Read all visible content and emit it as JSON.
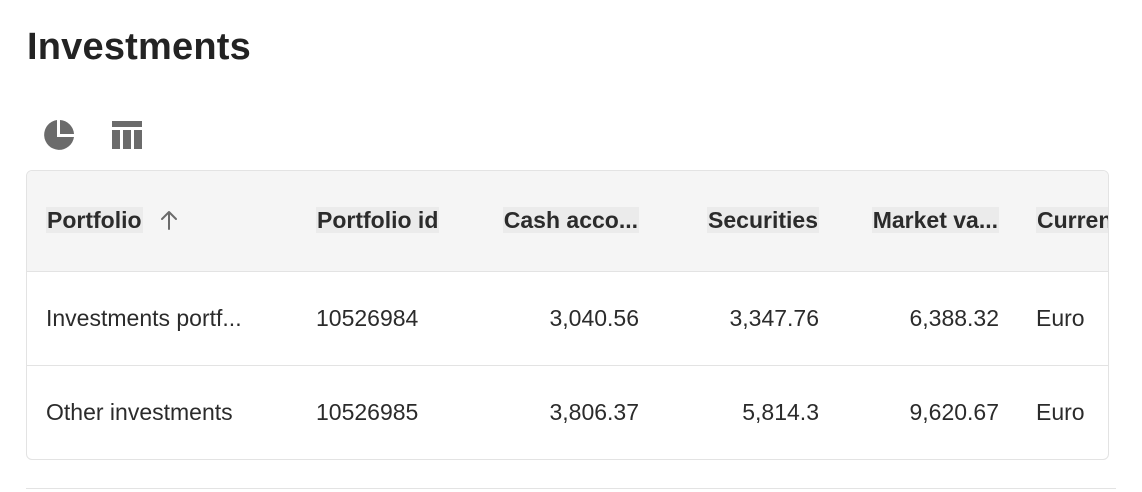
{
  "page": {
    "title": "Investments"
  },
  "view_toggle": {
    "icons": [
      "pie-chart-icon",
      "table-icon"
    ]
  },
  "table": {
    "columns": [
      {
        "key": "portfolio",
        "label": "Portfolio",
        "sorted": "ascending"
      },
      {
        "key": "portfolio_id",
        "label": "Portfolio id"
      },
      {
        "key": "cash_account",
        "label": "Cash acco..."
      },
      {
        "key": "securities",
        "label": "Securities"
      },
      {
        "key": "market_value",
        "label": "Market va..."
      },
      {
        "key": "currency",
        "label": "Currency"
      }
    ],
    "rows": [
      {
        "portfolio": "Investments portf...",
        "portfolio_id": "10526984",
        "cash_account": "3,040.56",
        "securities": "3,347.76",
        "market_value": "6,388.32",
        "currency": "Euro"
      },
      {
        "portfolio": "Other investments",
        "portfolio_id": "10526985",
        "cash_account": "3,806.37",
        "securities": "5,814.3",
        "market_value": "9,620.67",
        "currency": "Euro"
      }
    ]
  },
  "colors": {
    "header_bg": "#f5f5f5",
    "border": "#e3e3e3",
    "text": "#2b2b2b",
    "icon": "#6b6b6b"
  }
}
